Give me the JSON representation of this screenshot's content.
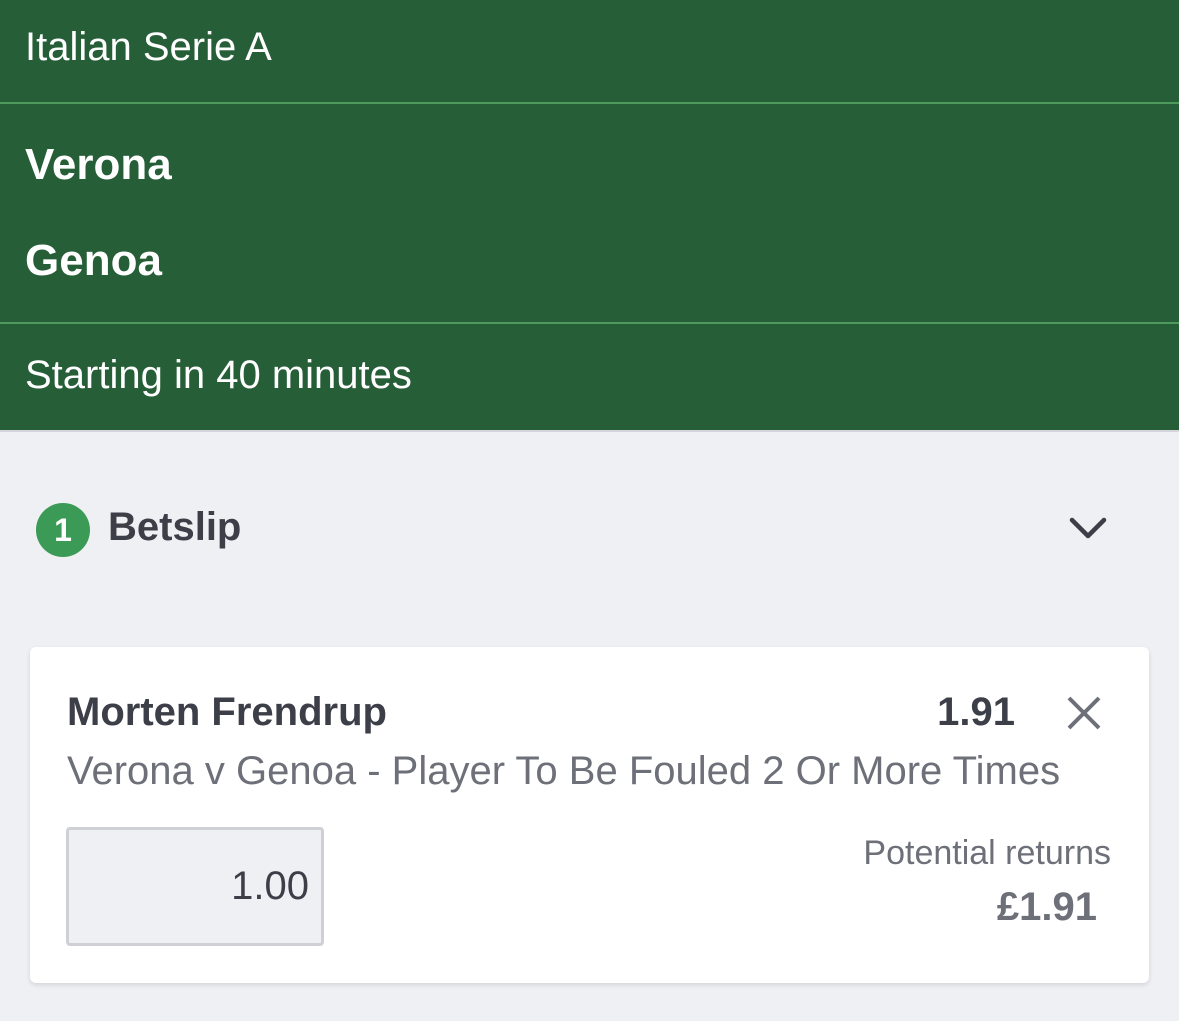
{
  "event": {
    "competition": "Italian Serie A",
    "home_team": "Verona",
    "away_team": "Genoa",
    "status": "Starting in 40 minutes"
  },
  "betslip": {
    "count": "1",
    "title": "Betslip",
    "toggle_icon": "chevron-down-icon"
  },
  "bet": {
    "selection": "Morten Frendrup",
    "odds": "1.91",
    "market": "Verona v Genoa - Player To Be Fouled 2 Or More Times",
    "stake": "1.00",
    "returns_label": "Potential returns",
    "returns_value": "£1.91",
    "remove_icon": "close-icon"
  },
  "colors": {
    "header_green": "#265e38",
    "badge_green": "#3b9a55",
    "background": "#eff0f4"
  }
}
